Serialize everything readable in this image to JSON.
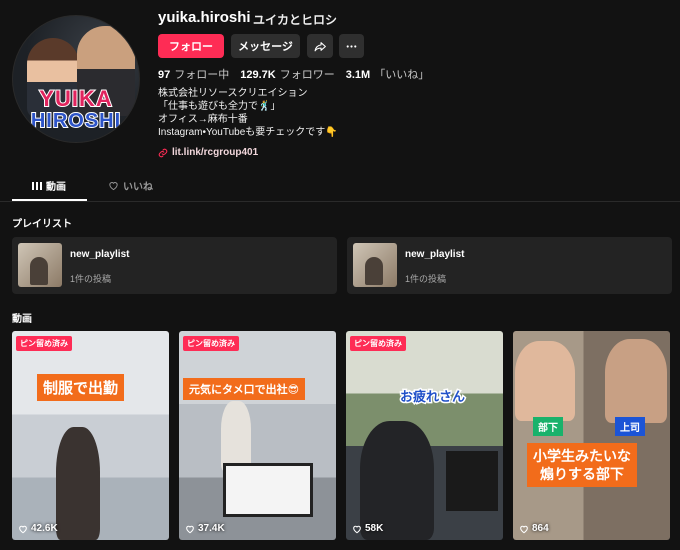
{
  "profile": {
    "username": "yuika.hiroshi",
    "nickname": "ユイカとヒロシ",
    "avatar_text": [
      "YUIKA",
      "HIROSHI"
    ],
    "follow_label": "フォロー",
    "message_label": "メッセージ",
    "share_icon": "share-icon",
    "more_icon": "more-icon",
    "stats": {
      "following": {
        "value": "97",
        "label": "フォロー中"
      },
      "followers": {
        "value": "129.7K",
        "label": "フォロワー"
      },
      "likes": {
        "value": "3.1M",
        "label": "「いいね」"
      }
    },
    "bio": [
      "株式会社リソースクリエイション",
      "「仕事も遊びも全力で🕺」",
      "オフィス→麻布十番",
      "Instagram•YouTubeも要チェックです👇"
    ],
    "link": "lit.link/rcgroup401"
  },
  "tabs": [
    {
      "label": "動画",
      "icon": "grid-icon",
      "active": true
    },
    {
      "label": "いいね",
      "icon": "heart-outline-icon",
      "active": false
    }
  ],
  "playlists_title": "プレイリスト",
  "playlists": [
    {
      "name": "new_playlist",
      "count": "1件の投稿"
    },
    {
      "name": "new_playlist",
      "count": "1件の投稿"
    }
  ],
  "videos_title": "動画",
  "videos": [
    {
      "pinned": "ピン留め済み",
      "caption": "制服で出勤",
      "views": "42.6K"
    },
    {
      "pinned": "ピン留め済み",
      "caption": "元気にタメ口で出社😎",
      "views": "37.4K"
    },
    {
      "pinned": "ピン留め済み",
      "caption": "お疲れさん",
      "views": "58K"
    },
    {
      "pinned": "",
      "caption": [
        "小学生みたいな",
        "煽りする部下"
      ],
      "tags": [
        "部下",
        "上司"
      ],
      "views": "864"
    }
  ],
  "colors": {
    "accent": "#fe2c55",
    "background": "#121212",
    "card": "#232323",
    "caption_orange": "#f26c1b"
  }
}
